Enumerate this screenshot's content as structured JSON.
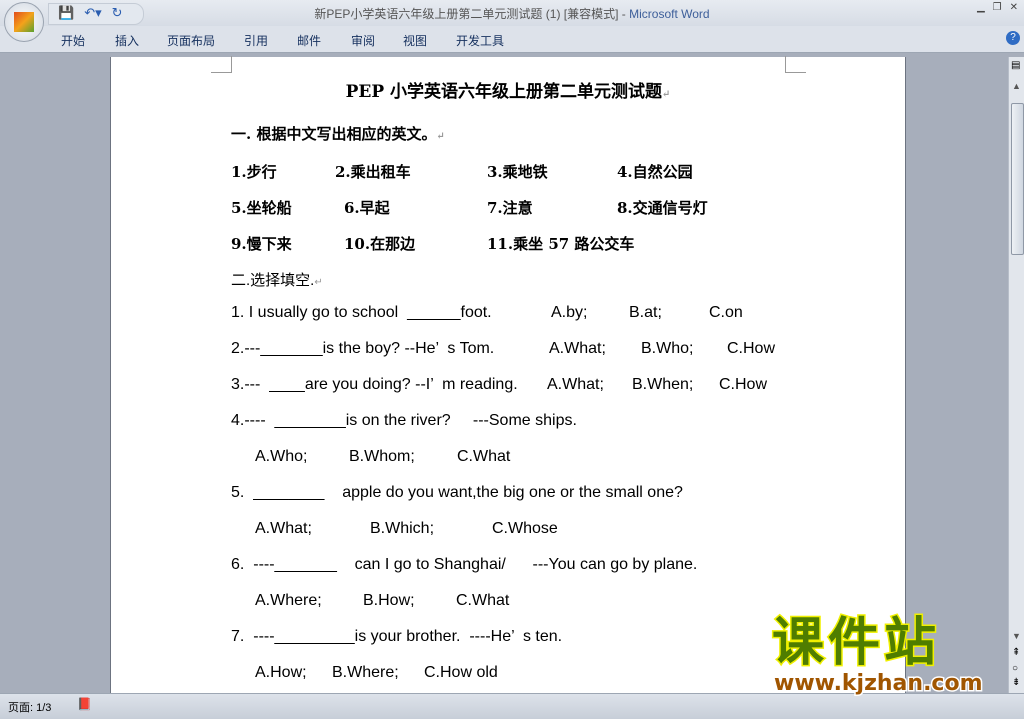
{
  "window": {
    "title": "新PEP小学英语六年级上册第二单元测试题 (1) [兼容模式]",
    "app": "Microsoft Word"
  },
  "ribbon": {
    "tabs": [
      "开始",
      "插入",
      "页面布局",
      "引用",
      "邮件",
      "审阅",
      "视图",
      "开发工具"
    ]
  },
  "doc": {
    "title": "PEP 小学英语六年级上册第二单元测试题",
    "section1": "一. 根据中文写出相应的英文。",
    "r1": [
      "1.步行",
      "2.乘出租车",
      "3.乘地铁",
      "4.自然公园"
    ],
    "r2": [
      "5.坐轮船",
      "6.早起",
      "7.注意",
      "8.交通信号灯"
    ],
    "r3": [
      "9.慢下来",
      "10.在那边",
      "11.乘坐 57 路公交车"
    ],
    "section2": "二.选择填空.",
    "q": [
      [
        "1. I usually go to school  ______foot.",
        "A.by;",
        "B.at;",
        "C.on"
      ],
      [
        "2.---_______is the boy? --He’  s Tom.",
        "A.What;",
        "B.Who;",
        "C.How"
      ],
      [
        "3.---  ____are you doing? --I’  m reading.",
        "A.What;",
        "B.When;",
        "C.How"
      ],
      [
        "4.----  ________is on the river?     ---Some ships."
      ],
      [
        "A.Who;",
        "B.Whom;",
        "C.What"
      ],
      [
        "5.  ________    apple do you want,the big one or the small one?"
      ],
      [
        "A.What;",
        "B.Which;",
        "C.Whose"
      ],
      [
        "6.  ----_______    can I go to Shanghai/      ---You can go by plane."
      ],
      [
        "A.Where;",
        "B.How;",
        "C.What"
      ],
      [
        "7.  ----_________is your brother.  ----He’  s ten."
      ],
      [
        "A.How;",
        "B.Where;",
        "C.How old"
      ]
    ]
  },
  "statusbar": {
    "page": "页面: 1/3"
  },
  "watermark": {
    "cn": "课件站",
    "url": "www.kjzhan.com"
  },
  "colors": {
    "accent": "#3d5f9a",
    "watermark_green": "#4f7d00"
  }
}
